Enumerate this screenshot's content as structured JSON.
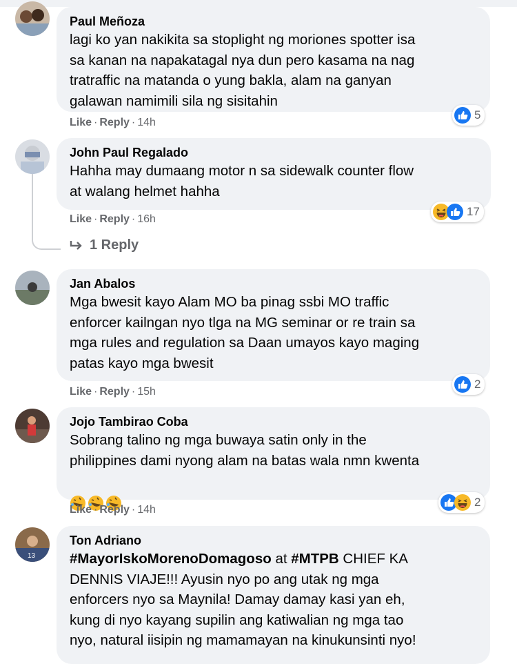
{
  "comments": [
    {
      "author": "Paul Meñoza",
      "text": "lagi ko yan nakikita sa stoplight ng moriones spotter isa\nsa kanan na napakatagal nya dun pero kasama na nag\ntratraffic na matanda o yung bakla, alam na ganyan\ngalawan namimili sila ng sisitahin",
      "like": "Like",
      "reply": "Reply",
      "time": "14h",
      "reactions": [
        "like"
      ],
      "reaction_count": "5"
    },
    {
      "author": "John Paul Regalado",
      "text": "Hahha may dumaang motor n sa sidewalk counter flow\nat walang helmet hahha",
      "like": "Like",
      "reply": "Reply",
      "time": "16h",
      "reactions": [
        "haha",
        "like"
      ],
      "reaction_count": "17",
      "replies_label": "1 Reply"
    },
    {
      "author": "Jan Abalos",
      "text": "Mga bwesit kayo Alam MO ba pinag ssbi MO traffic\nenforcer kailngan nyo tlga na MG seminar or re train sa\nmga rules and regulation sa Daan umayos kayo maging\npatas kayo mga bwesit",
      "like": "Like",
      "reply": "Reply",
      "time": "15h",
      "reactions": [
        "like"
      ],
      "reaction_count": "2"
    },
    {
      "author": "Jojo Tambirao Coba",
      "text": "Sobrang talino ng mga buwaya satin only in the\nphilippines dami nyong alam na batas wala nmn kwenta",
      "emoji_line": "🤣🤣🤣",
      "like": "Like",
      "reply": "Reply",
      "time": "14h",
      "reactions": [
        "like",
        "haha"
      ],
      "reaction_count": "2"
    },
    {
      "author": "Ton Adriano",
      "hashtag1": "#MayorIskoMorenoDomagoso",
      "mid1": " at ",
      "hashtag2": "#MTPB",
      "text_rest": " CHIEF KA\nDENNIS VIAJE!!! Ayusin nyo po ang utak ng mga\nenforcers nyo sa Maynila! Damay damay kasi yan eh,\nkung di nyo kayang supilin ang katiwalian ng mga tao\nnyo, natural iisipin ng mamamayan na kinukunsinti nyo!"
    }
  ],
  "colors": {
    "like_blue": "#1877f2",
    "bubble_bg": "#f0f2f5",
    "meta_gray": "#65676b",
    "haha_yellow": "#f7b928"
  },
  "separator": "·"
}
